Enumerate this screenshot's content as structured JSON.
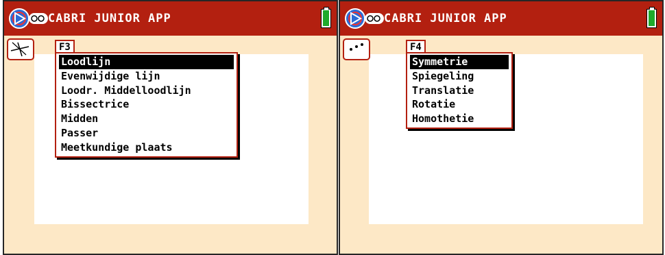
{
  "app_title": "CABRI JUNIOR APP",
  "colors": {
    "title_bar": "#b32010",
    "screen_bg": "#fde8c6",
    "canvas": "#ffffff",
    "battery": "#1faa2c",
    "menu_border": "#b32010",
    "highlight": "#000000"
  },
  "battery_level": 0.88,
  "left_screen": {
    "toolbox_icon": "line-construction-icon",
    "menu": {
      "tab": "F3",
      "items": [
        {
          "label": "Loodlijn",
          "selected": true
        },
        {
          "label": "Evenwijdige lijn",
          "selected": false
        },
        {
          "label": "Loodr. Middelloodlijn",
          "selected": false
        },
        {
          "label": "Bissectrice",
          "selected": false
        },
        {
          "label": "Midden",
          "selected": false
        },
        {
          "label": "Passer",
          "selected": false
        },
        {
          "label": "Meetkundige plaats",
          "selected": false
        }
      ]
    }
  },
  "right_screen": {
    "toolbox_icon": "points-icon",
    "menu": {
      "tab": "F4",
      "items": [
        {
          "label": "Symmetrie",
          "selected": true
        },
        {
          "label": "Spiegeling",
          "selected": false
        },
        {
          "label": "Translatie",
          "selected": false
        },
        {
          "label": "Rotatie",
          "selected": false
        },
        {
          "label": "Homothetie",
          "selected": false
        }
      ]
    }
  }
}
